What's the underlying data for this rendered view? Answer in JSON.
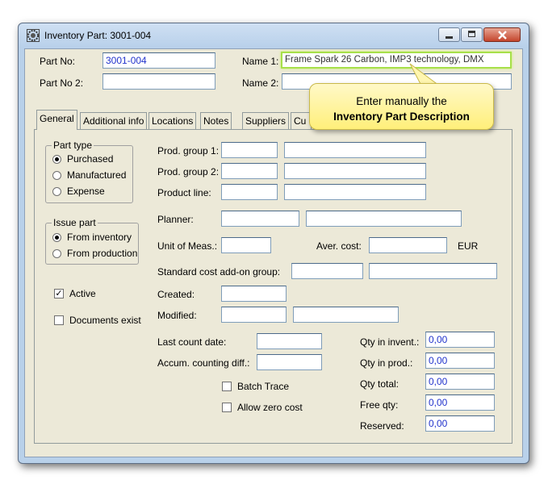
{
  "window": {
    "title": "Inventory Part: 3001-004",
    "icon": "gear-icon"
  },
  "header": {
    "part_no_label": "Part No:",
    "part_no_value": "3001-004",
    "part_no2_label": "Part No 2:",
    "part_no2_value": "",
    "name1_label": "Name 1:",
    "name1_value": "Frame Spark 26 Carbon, IMP3 technology, DMX",
    "name2_label": "Name 2:",
    "name2_value": ""
  },
  "callout": {
    "line1": "Enter manually the",
    "line2": "Inventory Part Description"
  },
  "tabs": [
    {
      "label": "General",
      "active": true
    },
    {
      "label": "Additional info",
      "active": false
    },
    {
      "label": "Locations",
      "active": false
    },
    {
      "label": "Notes",
      "active": false
    },
    {
      "label": "Suppliers",
      "active": false
    },
    {
      "label": "Cu",
      "active": false
    }
  ],
  "part_type": {
    "legend": "Part type",
    "options": [
      "Purchased",
      "Manufactured",
      "Expense"
    ],
    "selected": "Purchased"
  },
  "issue_part": {
    "legend": "Issue part",
    "options": [
      "From inventory",
      "From production"
    ],
    "selected": "From inventory"
  },
  "checks": {
    "active_label": "Active",
    "active": true,
    "documents_label": "Documents exist",
    "documents": false,
    "batch_label": "Batch Trace",
    "batch": false,
    "zero_cost_label": "Allow zero cost",
    "zero_cost": false
  },
  "fields": {
    "prod_group1": "Prod. group 1:",
    "prod_group2": "Prod. group 2:",
    "product_line": "Product line:",
    "planner": "Planner:",
    "unit": "Unit of Meas.:",
    "aver_cost": "Aver. cost:",
    "currency": "EUR",
    "std_cost": "Standard cost add-on group:",
    "created": "Created:",
    "modified": "Modified:",
    "last_count": "Last count date:",
    "accum": "Accum. counting diff.:"
  },
  "quantities": [
    {
      "label": "Qty in invent.:",
      "value": "0,00"
    },
    {
      "label": "Qty in prod.:",
      "value": "0,00"
    },
    {
      "label": "Qty total:",
      "value": "0,00"
    },
    {
      "label": "Free qty:",
      "value": "0,00"
    },
    {
      "label": "Reserved:",
      "value": "0,00"
    }
  ]
}
